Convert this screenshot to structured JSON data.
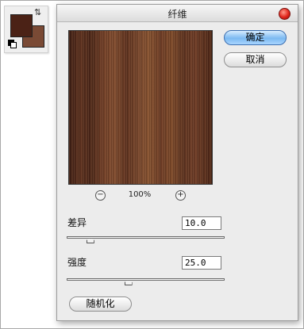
{
  "dialog": {
    "title": "纤维",
    "ok_label": "确定",
    "cancel_label": "取消",
    "randomize_label": "随机化"
  },
  "preview": {
    "zoom_level": "100%",
    "zoom_out_symbol": "−",
    "zoom_in_symbol": "+"
  },
  "params": {
    "variance": {
      "label": "差异",
      "value": "10.0",
      "slider_fraction": 0.15
    },
    "strength": {
      "label": "强度",
      "value": "25.0",
      "slider_fraction": 0.39
    }
  },
  "colors": {
    "foreground": "#4b2216",
    "background": "#7a4a35"
  },
  "icons": {
    "swap": "swap-colors-icon",
    "default": "default-colors-icon",
    "close": "close-icon",
    "zoom_out": "zoom-out-icon",
    "zoom_in": "zoom-in-icon"
  }
}
